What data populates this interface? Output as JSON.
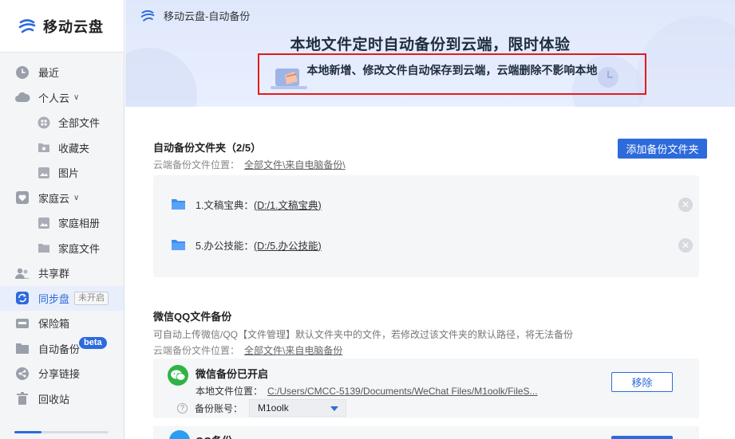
{
  "app": {
    "name": "移动云盘",
    "window_title": "移动云盘-自动备份"
  },
  "sidebar": {
    "items": [
      {
        "label": "最近"
      },
      {
        "label": "个人云"
      },
      {
        "label": "全部文件"
      },
      {
        "label": "收藏夹"
      },
      {
        "label": "图片"
      },
      {
        "label": "家庭云"
      },
      {
        "label": "家庭相册"
      },
      {
        "label": "家庭文件"
      },
      {
        "label": "共享群"
      },
      {
        "label": "同步盘",
        "badge": "未开启"
      },
      {
        "label": "保险箱"
      },
      {
        "label": "自动备份",
        "badge": "beta"
      },
      {
        "label": "分享链接"
      },
      {
        "label": "回收站"
      }
    ]
  },
  "banner": {
    "title": "本地文件定时自动备份到云端，限时体验",
    "subtitle": "本地新增、修改文件自动保存到云端，云端删除不影响本地"
  },
  "backup_folders": {
    "title": "自动备份文件夹（2/5）",
    "location_label": "云端备份文件位置：",
    "location_path": "全部文件\\来自电脑备份\\",
    "add_button": "添加备份文件夹",
    "folders": [
      {
        "name": "1.文稿宝典：",
        "path": "(D:/1.文稿宝典)"
      },
      {
        "name": "5.办公技能：",
        "path": "(D:/5.办公技能)"
      }
    ]
  },
  "wechat_qq": {
    "title": "微信QQ文件备份",
    "desc": "可自动上传微信/QQ【文件管理】默认文件夹中的文件，若修改过该文件夹的默认路径，将无法备份",
    "location_label": "云端备份文件位置：",
    "location_path": "全部文件\\来自电脑备份",
    "wechat": {
      "title": "微信备份已开启",
      "local_label": "本地文件位置：",
      "local_path": "C:/Users/CMCC-5139/Documents/WeChat Files/M1oolk/FileS...",
      "account_label": "备份账号：",
      "account_value": "M1oolk",
      "remove_button": "移除"
    },
    "qq": {
      "title": "QQ备份"
    }
  },
  "colors": {
    "accent": "#2d6bdc",
    "highlight_border": "#e5191f",
    "wechat_green": "#2fb344"
  }
}
